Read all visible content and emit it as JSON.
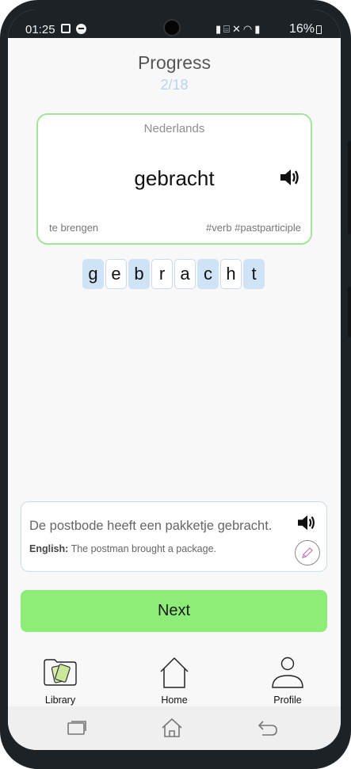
{
  "status_bar": {
    "time": "01:25",
    "icons": [
      "gallery-icon",
      "dnd-icon",
      "battery-saver-icon",
      "sleep-icon",
      "mute-icon",
      "wifi-icon",
      "signal-icon"
    ],
    "battery": "16%"
  },
  "progress": {
    "title": "Progress",
    "count": "2/18"
  },
  "card": {
    "language": "Nederlands",
    "word": "gebracht",
    "infinitive": "te brengen",
    "tags": "#verb #pastparticiple"
  },
  "letters": [
    {
      "char": "g",
      "highlighted": true
    },
    {
      "char": "e",
      "highlighted": false
    },
    {
      "char": "b",
      "highlighted": true
    },
    {
      "char": "r",
      "highlighted": false
    },
    {
      "char": "a",
      "highlighted": false
    },
    {
      "char": "c",
      "highlighted": true
    },
    {
      "char": "h",
      "highlighted": false
    },
    {
      "char": "t",
      "highlighted": true
    }
  ],
  "example": {
    "sentence": "De postbode heeft een pakketje gebracht.",
    "english_label": "English:",
    "english_text": "The postman brought a package."
  },
  "next_label": "Next",
  "nav": {
    "library": "Library",
    "home": "Home",
    "profile": "Profile"
  },
  "colors": {
    "accent_green": "#8ded78",
    "card_border": "#a3e49a",
    "tile_highlight": "#cfe3f7",
    "progress_blue": "#b6d4f0"
  }
}
